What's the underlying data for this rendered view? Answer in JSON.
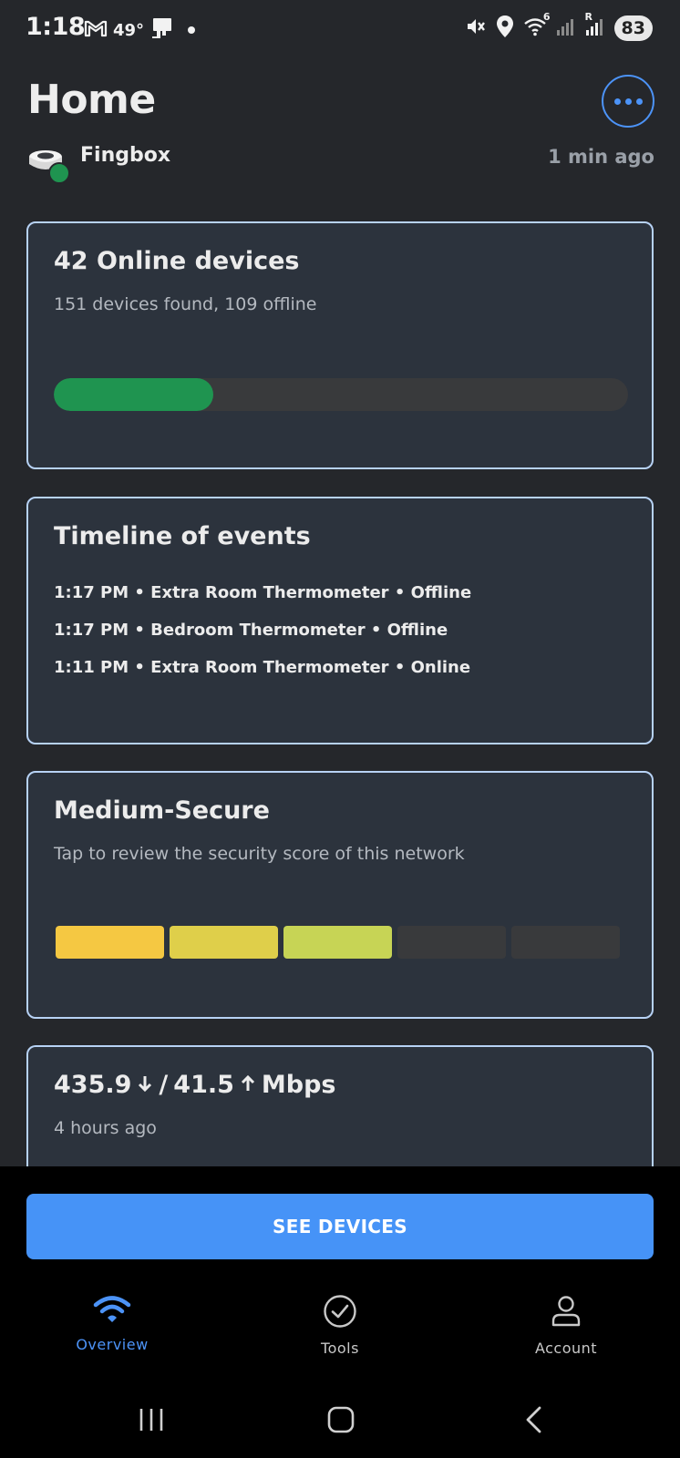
{
  "status_bar": {
    "time": "1:18",
    "temperature": "49°",
    "signal_badge": "6",
    "roaming_badge": "R",
    "battery": "83"
  },
  "header": {
    "title": "Home",
    "more_icon": "more-horizontal-icon"
  },
  "network": {
    "device_name": "Fingbox",
    "last_seen": "1 min ago",
    "status_color": "#1f9450"
  },
  "cards": {
    "devices": {
      "title": "42 Online devices",
      "subtitle": "151 devices found, 109 offline",
      "online_fraction": 0.278,
      "bar_color": "#1f9450"
    },
    "timeline": {
      "title": "Timeline of events",
      "events": [
        "1:17 PM • Extra Room Thermometer • Offline",
        "1:17 PM • Bedroom Thermometer • Offline",
        "1:11 PM • Extra Room Thermometer • Online"
      ]
    },
    "security": {
      "title": "Medium-Secure",
      "subtitle": "Tap to review the security score of this network",
      "score_level": 3,
      "score_max": 5,
      "level_colors": [
        "#f5c842",
        "#dfcf4a",
        "#c7d455",
        "#393a3c",
        "#393a3c"
      ]
    },
    "speed": {
      "download": "435.9",
      "separator": "/",
      "upload": "41.5",
      "unit": "Mbps",
      "subtitle": "4 hours ago"
    }
  },
  "actions": {
    "see_devices": "SEE DEVICES"
  },
  "tabs": [
    {
      "label": "Overview",
      "icon": "wifi-icon",
      "active": true
    },
    {
      "label": "Tools",
      "icon": "check-circle-icon",
      "active": false
    },
    {
      "label": "Account",
      "icon": "person-icon",
      "active": false
    }
  ],
  "colors": {
    "accent": "#4693f7",
    "background": "#25272b",
    "card": "#2c333d",
    "card_border": "#b7d2f5"
  }
}
